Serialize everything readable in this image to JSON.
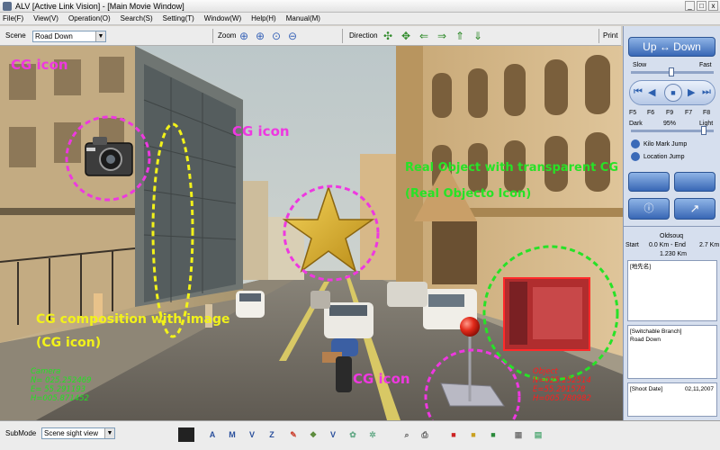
{
  "window": {
    "title": "ALV [Active Link Vision] - [Main Movie Window]",
    "buttons": [
      "_",
      "□",
      "x"
    ]
  },
  "menu": [
    "File(F)",
    "View(V)",
    "Operation(O)",
    "Search(S)",
    "Setting(T)",
    "Window(W)",
    "Help(H)",
    "Manual(M)"
  ],
  "toolbar": {
    "scene_label": "Scene",
    "scene_value": "Road Down",
    "zoom_label": "Zoom",
    "direction_label": "Direction",
    "print_label": "Print"
  },
  "annotations": {
    "cg_icon_top": "CG icon",
    "cg_icon_star": "CG icon",
    "cg_icon_pin": "CG icon",
    "real_object_line1": "Real Object with transparent CG",
    "real_object_line2": "(Real Objecto Icon)",
    "cg_composition_line1": "CG composition with image",
    "cg_composition_line2": "(CG icon)"
  },
  "camera_hud": [
    "Camera",
    "N= 025.252469",
    "E= 55.291193",
    "H=005.871452"
  ],
  "object_hud": [
    "Object",
    "N=025.252514",
    "E=55.291578",
    "H=005.780982"
  ],
  "right_panel": {
    "direction_button": "Up ↔ Down",
    "slow_label": "Slow",
    "fast_label": "Fast",
    "fkeys": [
      "F5",
      "F6",
      "F9",
      "F7",
      "F8"
    ],
    "dark_label": "Dark",
    "light_label": "Light",
    "brightness": "95%",
    "kilo_mark": "Kilo Mark Jump",
    "location_jump": "Location Jump",
    "location_name": "Oldsouq",
    "start_label": "Start",
    "start_value": "0.0 Km - End",
    "end_value": "2.7 Km",
    "current_km": "1.230 Km",
    "place_name_header": "[地先名]",
    "switchable_header": "[Switchable Branch]",
    "switchable_value": "Road Down",
    "shoot_date_label": "[Shoot Date]",
    "shoot_date_value": "02,11,2007"
  },
  "bottom_bar": {
    "submode_label": "SubMode",
    "submode_value": "Scene sight view",
    "icons": [
      "A",
      "M",
      "V",
      "Z",
      "V"
    ]
  },
  "colors": {
    "annotation_pink": "#ee38e0",
    "annotation_yellow": "#f2f21a",
    "annotation_green": "#27e227",
    "hud_green": "#24e024",
    "hud_red": "#ff1d1d",
    "button_blue": "#3867b5"
  }
}
